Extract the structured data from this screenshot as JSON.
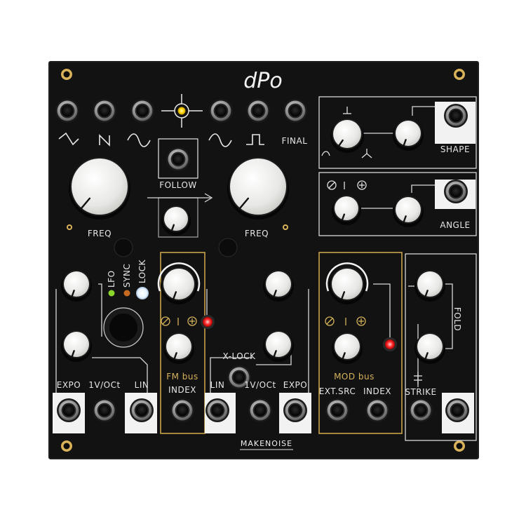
{
  "panel": {
    "logo": "dPo",
    "brand": "MAKENOISE"
  },
  "labels": {
    "final": "FINAL",
    "shape": "SHAPE",
    "follow": "FOLLOW",
    "angle": "ANGLE",
    "freq_left": "FREQ",
    "freq_right": "FREQ",
    "fm_bus": "FM bus",
    "mod_bus": "MOD bus",
    "index": "INDEX",
    "x_lock": "X-LOCK",
    "lin_left": "LIN",
    "lin_right": "LIN",
    "voct_left": "1V/OCt",
    "voct_right": "1V/OCt",
    "expo_left": "EXPO",
    "expo_right": "EXPO",
    "ext_src": "EXT.SRC",
    "mod_index": "INDEX",
    "strike": "STRIKE",
    "fold": "FOLD",
    "lfo": "LFO",
    "sync": "SYNC",
    "lock": "LOCK"
  },
  "colors": {
    "panel": "#121212",
    "line": "#dcdcdc",
    "gold": "#c9a24a",
    "knob": "#f3f3f1",
    "jack_body": "#0d0d0d",
    "jack_ring": "#b7b7b7",
    "led_red": "#ff2b2b",
    "led_yellow": "#ffd400",
    "led_white": "#f0f7ff",
    "led_orange": "#c66a1f",
    "led_green": "#8ad62a"
  }
}
